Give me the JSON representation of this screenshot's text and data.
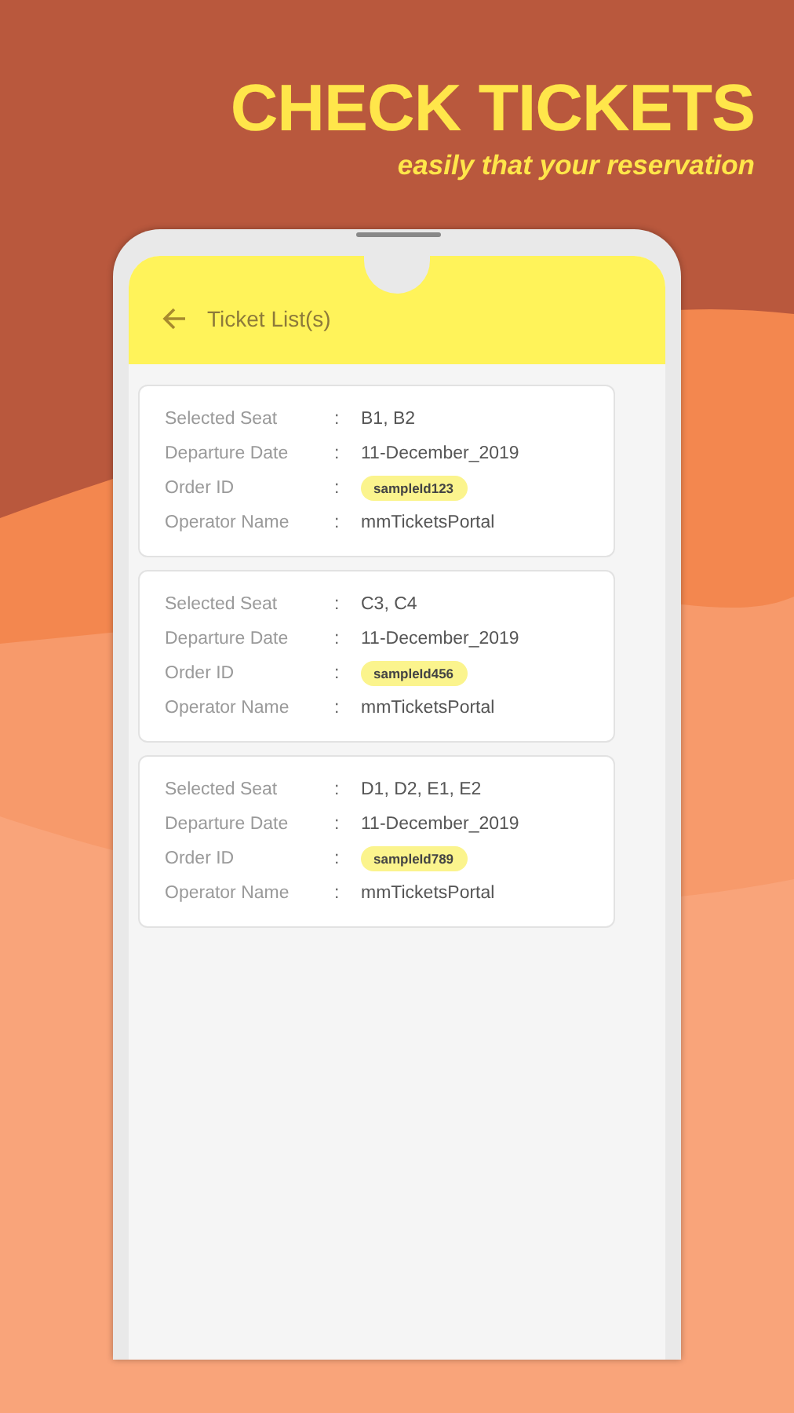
{
  "headline": {
    "title": "CHECK TICKETS",
    "subtitle": "easily that your reservation"
  },
  "app_bar": {
    "title": "Ticket List(s)"
  },
  "tickets": [
    {
      "fields": [
        {
          "label": "Selected Seat",
          "value": "B1, B2",
          "kind": "text"
        },
        {
          "label": "Departure Date",
          "value": "11-December_2019",
          "kind": "text"
        },
        {
          "label": "Order ID",
          "value": "sampleId123",
          "kind": "tag"
        },
        {
          "label": "Operator Name",
          "value": "mmTicketsPortal",
          "kind": "text"
        }
      ]
    },
    {
      "fields": [
        {
          "label": "Selected Seat",
          "value": "C3, C4",
          "kind": "text"
        },
        {
          "label": "Departure Date",
          "value": "11-December_2019",
          "kind": "text"
        },
        {
          "label": "Order ID",
          "value": "sampleId456",
          "kind": "tag"
        },
        {
          "label": "Operator Name",
          "value": "mmTicketsPortal",
          "kind": "text"
        }
      ]
    },
    {
      "fields": [
        {
          "label": "Selected Seat",
          "value": "D1, D2, E1, E2",
          "kind": "text"
        },
        {
          "label": "Departure Date",
          "value": "11-December_2019",
          "kind": "text"
        },
        {
          "label": "Order ID",
          "value": "sampleId789",
          "kind": "tag"
        },
        {
          "label": "Operator Name",
          "value": "mmTicketsPortal",
          "kind": "text"
        }
      ]
    }
  ],
  "separator": ":"
}
